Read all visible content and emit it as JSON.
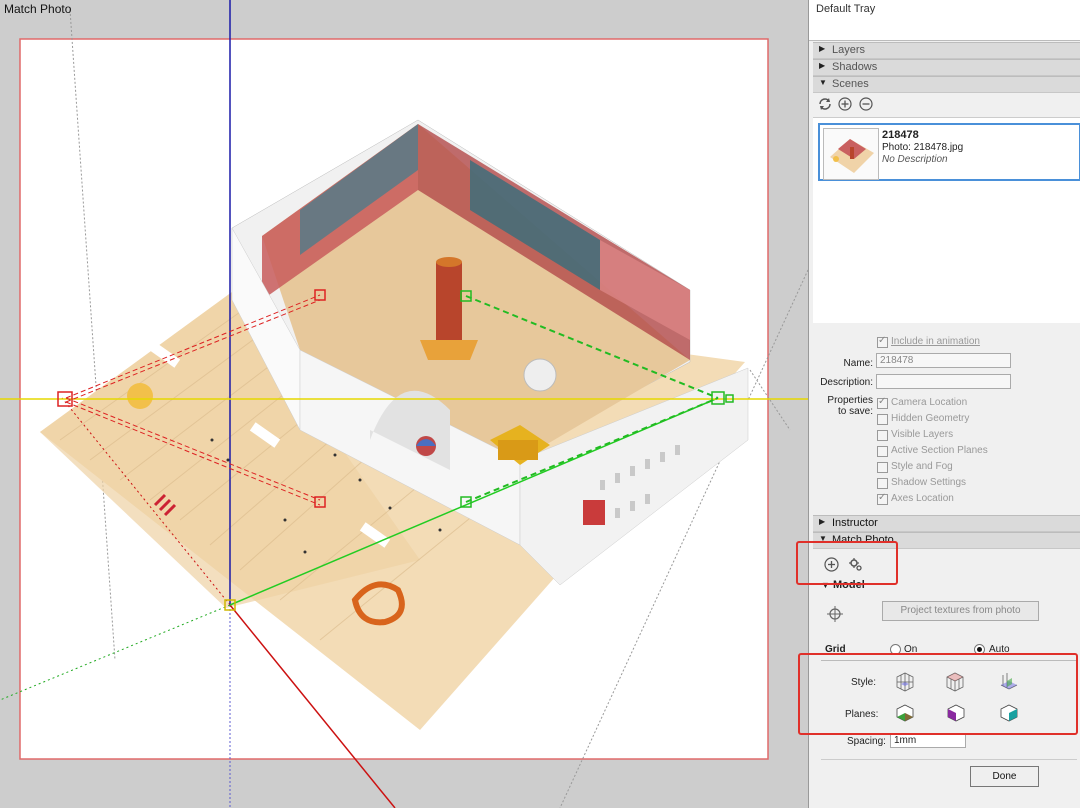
{
  "viewport": {
    "title": "Match Photo"
  },
  "tray": {
    "title": "Default Tray",
    "panels": {
      "layers": "Layers",
      "shadows": "Shadows",
      "scenes": "Scenes",
      "instructor": "Instructor",
      "match_photo": "Match Photo"
    },
    "scene": {
      "name": "218478",
      "photo": "Photo: 218478.jpg",
      "description": "No Description"
    },
    "properties": {
      "include_animation": "Include in animation",
      "name_label": "Name:",
      "name_value": "218478",
      "description_label": "Description:",
      "description_value": "",
      "props_label_1": "Properties",
      "props_label_2": "to save:",
      "options": [
        {
          "label": "Camera Location",
          "checked": true
        },
        {
          "label": "Hidden Geometry",
          "checked": false
        },
        {
          "label": "Visible Layers",
          "checked": false
        },
        {
          "label": "Active Section Planes",
          "checked": false
        },
        {
          "label": "Style and Fog",
          "checked": false
        },
        {
          "label": "Shadow Settings",
          "checked": false
        },
        {
          "label": "Axes Location",
          "checked": true
        }
      ]
    },
    "match_photo": {
      "model_label": "Model",
      "project_button": "Project textures from photo",
      "grid_label": "Grid",
      "grid_on": "On",
      "grid_auto": "Auto",
      "grid_selected": "Auto",
      "style_label": "Style:",
      "planes_label": "Planes:",
      "spacing_label": "Spacing:",
      "spacing_value": "1mm",
      "done_button": "Done"
    },
    "colors": {
      "highlight_box": "#e0302a",
      "selection_border": "#4a90d9",
      "axis_red": "#cc1111",
      "axis_green": "#22cc22",
      "axis_blue": "#1a1aa8",
      "horizon_yellow": "#e6d800"
    }
  }
}
